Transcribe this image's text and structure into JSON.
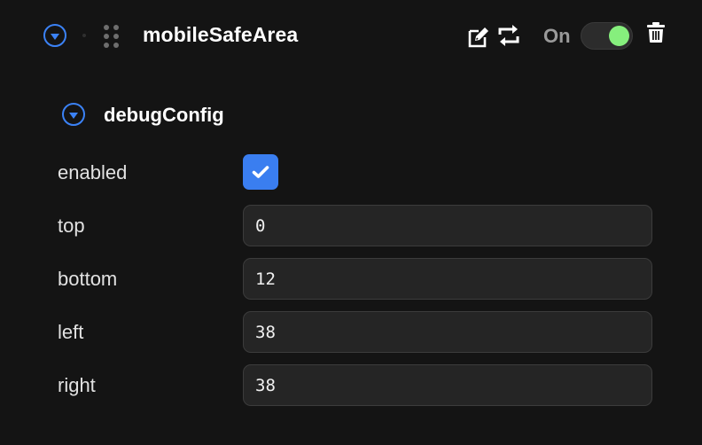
{
  "header": {
    "title": "mobileSafeArea",
    "toggle_label": "On",
    "toggle_on": true,
    "icons": {
      "collapse": "collapse-circle-icon",
      "drag": "drag-handle-icon",
      "edit": "edit-icon",
      "swap": "swap-icon",
      "delete": "trash-icon"
    }
  },
  "section": {
    "title": "debugConfig"
  },
  "fields": {
    "enabled": {
      "label": "enabled",
      "checked": true
    },
    "top": {
      "label": "top",
      "value": "0"
    },
    "bottom": {
      "label": "bottom",
      "value": "12"
    },
    "left": {
      "label": "left",
      "value": "38"
    },
    "right": {
      "label": "right",
      "value": "38"
    }
  },
  "colors": {
    "background": "#141414",
    "accent": "#3b82f6",
    "checkbox": "#3a7ef0",
    "toggle_knob": "#86ef7d",
    "field_bg": "#252525"
  }
}
